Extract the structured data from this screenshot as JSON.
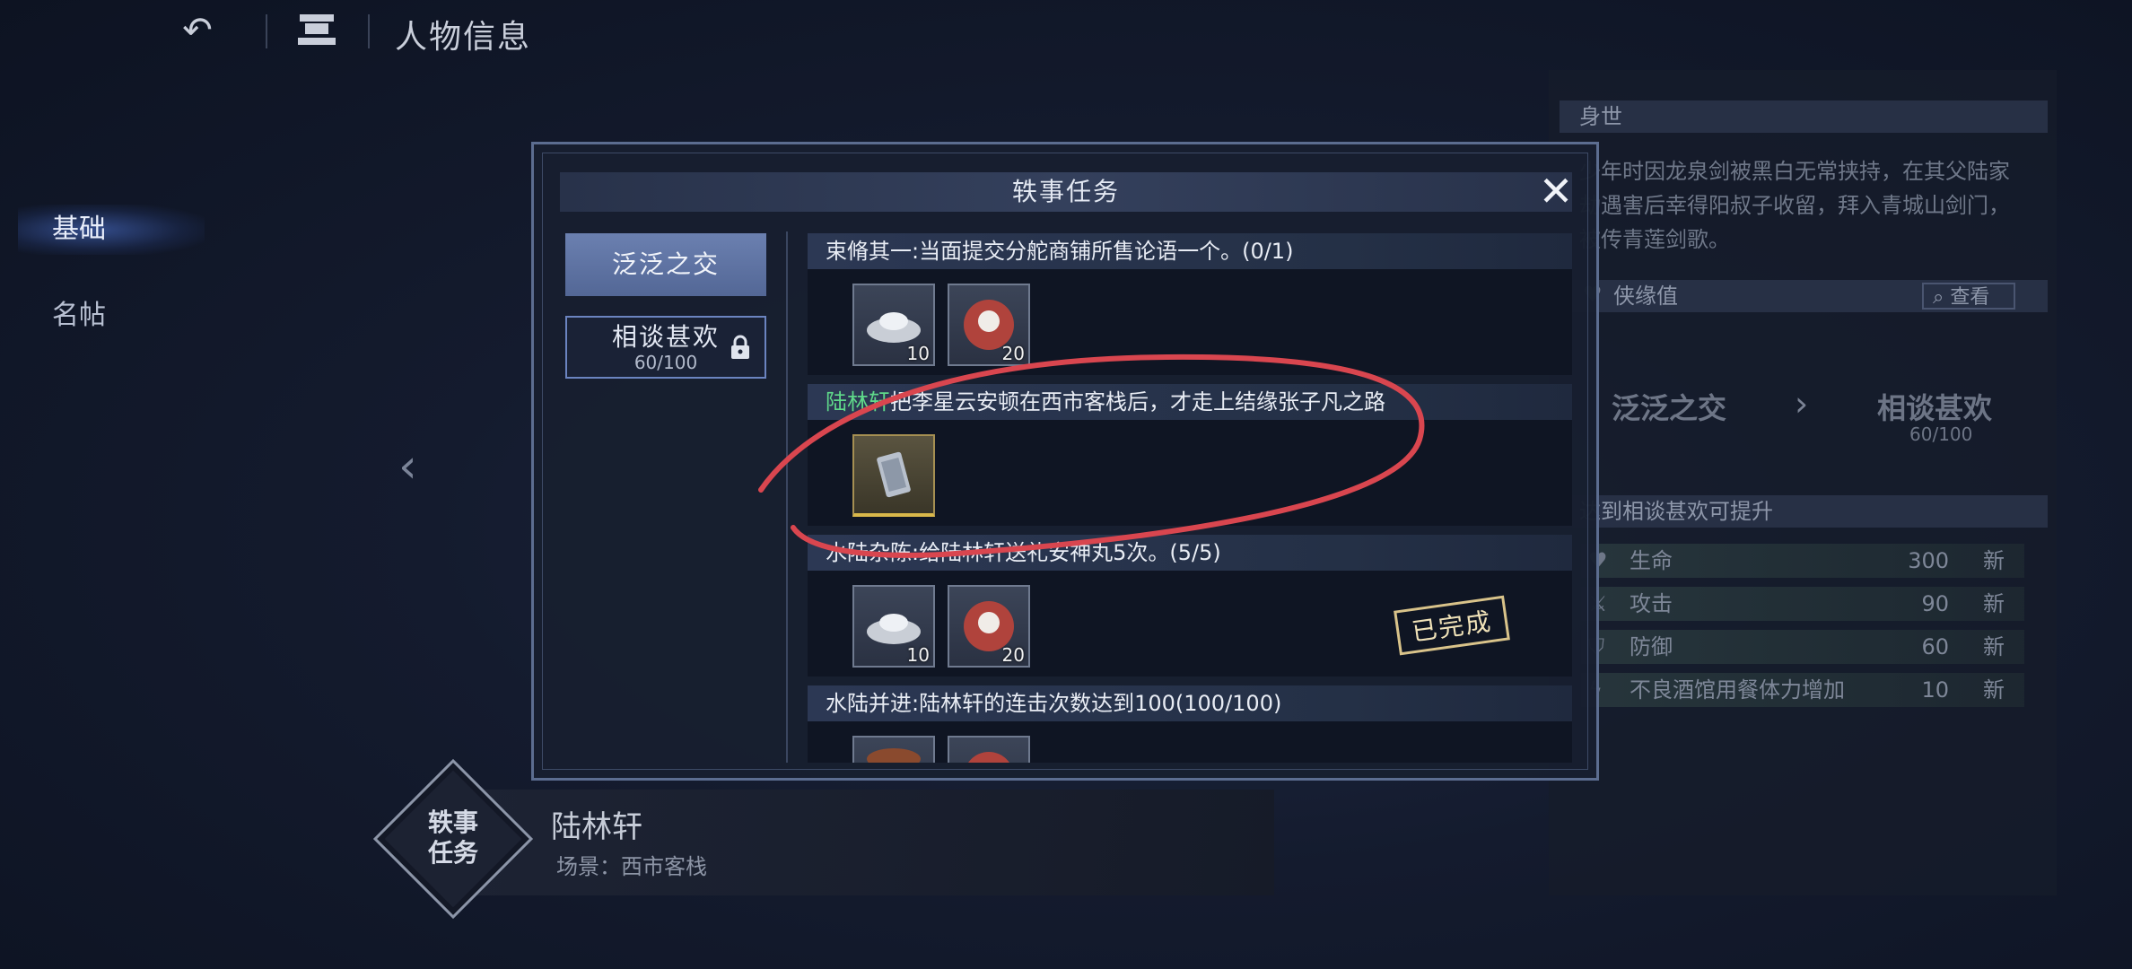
{
  "header": {
    "title": "人物信息"
  },
  "nav": {
    "items": [
      {
        "label": "基础"
      },
      {
        "label": "名帖"
      }
    ]
  },
  "character": {
    "badge_line1": "轶事",
    "badge_line2": "任务",
    "name": "陆林轩",
    "scene": "场景：西市客栈"
  },
  "right_panel": {
    "background_title": "身世",
    "background_text": "少年时因龙泉剑被黑白无常挟持，在其父陆家劫遇害后幸得阳叔子收留，拜入青城山剑门，被传青莲剑歌。",
    "affinity_title": "侠缘值",
    "view_label": "查看",
    "relation_from": "泛泛之交",
    "relation_to": "相谈甚欢",
    "relation_to_progress": "60/100",
    "upgrade_title": "达到相谈甚欢可提升",
    "stats": [
      {
        "label": "生命",
        "value": "300",
        "badge": "新",
        "icon": "heart-icon"
      },
      {
        "label": "攻击",
        "value": "90",
        "badge": "新",
        "icon": "sword-icon"
      },
      {
        "label": "防御",
        "value": "60",
        "badge": "新",
        "icon": "shield-icon"
      },
      {
        "label": "不良酒馆用餐体力增加",
        "value": "10",
        "badge": "新",
        "icon": "lightning-icon"
      }
    ]
  },
  "modal": {
    "title": "轶事任务",
    "tabs": [
      {
        "label": "泛泛之交"
      },
      {
        "label": "相谈甚欢",
        "progress": "60/100"
      }
    ],
    "tasks": [
      {
        "title": "束脩其一:当面提交分舵商铺所售论语一个。(0/1)",
        "rewards": [
          {
            "icon": "silver-ingot-icon",
            "count": "10"
          },
          {
            "icon": "gift-box-icon",
            "count": "20"
          }
        ]
      },
      {
        "title_highlight": "陆林轩",
        "title": "把李星云安顿在西市客栈后，才走上结缘张子凡之路",
        "rewards": [
          {
            "icon": "scroll-icon",
            "count": ""
          }
        ]
      },
      {
        "title": "水陆杂陈:给陆林轩送礼安神丸5次。(5/5)",
        "rewards": [
          {
            "icon": "silver-ingot-icon",
            "count": "10"
          },
          {
            "icon": "gift-box-icon",
            "count": "20"
          }
        ],
        "status": "已完成"
      },
      {
        "title": "水陆并进:陆林轩的连击次数达到100(100/100)",
        "rewards": [
          {
            "icon": "food-icon",
            "count": ""
          },
          {
            "icon": "gift-box-icon",
            "count": ""
          }
        ]
      }
    ]
  },
  "colors": {
    "accent": "#6b80b0",
    "highlight_name": "#5fd98a",
    "annotation": "#d9464f"
  }
}
